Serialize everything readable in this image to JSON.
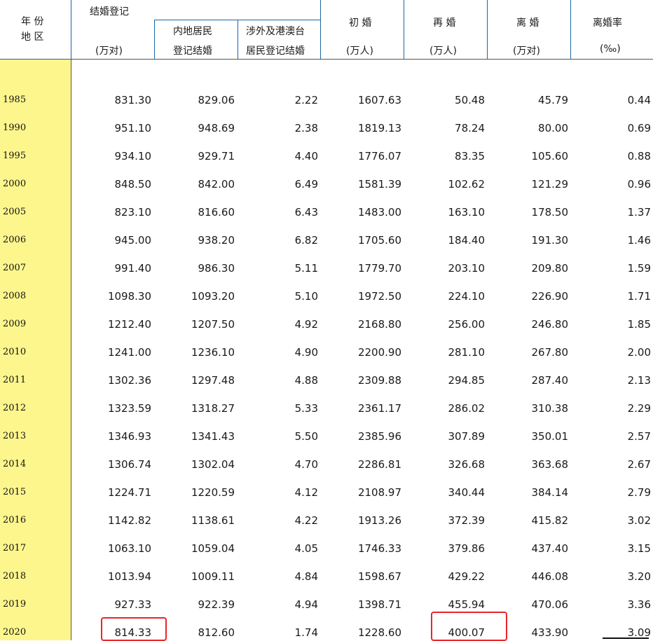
{
  "header": {
    "year_region_line1": "年 份",
    "year_region_line2": "地 区",
    "marriage_reg": "结婚登记",
    "marriage_reg_unit": "(万对)",
    "mainland_line1": "内地居民",
    "mainland_line2": "登记结婚",
    "foreign_line1": "涉外及港澳台",
    "foreign_line2": "居民登记结婚",
    "first_marriage": "初 婚",
    "first_marriage_unit": "(万人)",
    "remarriage": "再 婚",
    "remarriage_unit": "(万人)",
    "divorce": "离 婚",
    "divorce_unit": "(万对)",
    "divorce_rate": "离婚率",
    "divorce_rate_unit": "(‰)"
  },
  "rows": [
    {
      "year": "1985",
      "reg": "831.30",
      "mainland": "829.06",
      "foreign": "2.22",
      "first": "1607.63",
      "re": "50.48",
      "divorce": "45.79",
      "rate": "0.44"
    },
    {
      "year": "1990",
      "reg": "951.10",
      "mainland": "948.69",
      "foreign": "2.38",
      "first": "1819.13",
      "re": "78.24",
      "divorce": "80.00",
      "rate": "0.69"
    },
    {
      "year": "1995",
      "reg": "934.10",
      "mainland": "929.71",
      "foreign": "4.40",
      "first": "1776.07",
      "re": "83.35",
      "divorce": "105.60",
      "rate": "0.88"
    },
    {
      "year": "2000",
      "reg": "848.50",
      "mainland": "842.00",
      "foreign": "6.49",
      "first": "1581.39",
      "re": "102.62",
      "divorce": "121.29",
      "rate": "0.96"
    },
    {
      "year": "2005",
      "reg": "823.10",
      "mainland": "816.60",
      "foreign": "6.43",
      "first": "1483.00",
      "re": "163.10",
      "divorce": "178.50",
      "rate": "1.37"
    },
    {
      "year": "2006",
      "reg": "945.00",
      "mainland": "938.20",
      "foreign": "6.82",
      "first": "1705.60",
      "re": "184.40",
      "divorce": "191.30",
      "rate": "1.46"
    },
    {
      "year": "2007",
      "reg": "991.40",
      "mainland": "986.30",
      "foreign": "5.11",
      "first": "1779.70",
      "re": "203.10",
      "divorce": "209.80",
      "rate": "1.59"
    },
    {
      "year": "2008",
      "reg": "1098.30",
      "mainland": "1093.20",
      "foreign": "5.10",
      "first": "1972.50",
      "re": "224.10",
      "divorce": "226.90",
      "rate": "1.71"
    },
    {
      "year": "2009",
      "reg": "1212.40",
      "mainland": "1207.50",
      "foreign": "4.92",
      "first": "2168.80",
      "re": "256.00",
      "divorce": "246.80",
      "rate": "1.85"
    },
    {
      "year": "2010",
      "reg": "1241.00",
      "mainland": "1236.10",
      "foreign": "4.90",
      "first": "2200.90",
      "re": "281.10",
      "divorce": "267.80",
      "rate": "2.00"
    },
    {
      "year": "2011",
      "reg": "1302.36",
      "mainland": "1297.48",
      "foreign": "4.88",
      "first": "2309.88",
      "re": "294.85",
      "divorce": "287.40",
      "rate": "2.13"
    },
    {
      "year": "2012",
      "reg": "1323.59",
      "mainland": "1318.27",
      "foreign": "5.33",
      "first": "2361.17",
      "re": "286.02",
      "divorce": "310.38",
      "rate": "2.29"
    },
    {
      "year": "2013",
      "reg": "1346.93",
      "mainland": "1341.43",
      "foreign": "5.50",
      "first": "2385.96",
      "re": "307.89",
      "divorce": "350.01",
      "rate": "2.57"
    },
    {
      "year": "2014",
      "reg": "1306.74",
      "mainland": "1302.04",
      "foreign": "4.70",
      "first": "2286.81",
      "re": "326.68",
      "divorce": "363.68",
      "rate": "2.67"
    },
    {
      "year": "2015",
      "reg": "1224.71",
      "mainland": "1220.59",
      "foreign": "4.12",
      "first": "2108.97",
      "re": "340.44",
      "divorce": "384.14",
      "rate": "2.79"
    },
    {
      "year": "2016",
      "reg": "1142.82",
      "mainland": "1138.61",
      "foreign": "4.22",
      "first": "1913.26",
      "re": "372.39",
      "divorce": "415.82",
      "rate": "3.02"
    },
    {
      "year": "2017",
      "reg": "1063.10",
      "mainland": "1059.04",
      "foreign": "4.05",
      "first": "1746.33",
      "re": "379.86",
      "divorce": "437.40",
      "rate": "3.15"
    },
    {
      "year": "2018",
      "reg": "1013.94",
      "mainland": "1009.11",
      "foreign": "4.84",
      "first": "1598.67",
      "re": "429.22",
      "divorce": "446.08",
      "rate": "3.20"
    },
    {
      "year": "2019",
      "reg": "927.33",
      "mainland": "922.39",
      "foreign": "4.94",
      "first": "1398.71",
      "re": "455.94",
      "divorce": "470.06",
      "rate": "3.36"
    },
    {
      "year": "2020",
      "reg": "814.33",
      "mainland": "812.60",
      "foreign": "1.74",
      "first": "1228.60",
      "re": "400.07",
      "divorce": "433.90",
      "rate": "3.09"
    }
  ],
  "highlight_color": "#e8262b"
}
